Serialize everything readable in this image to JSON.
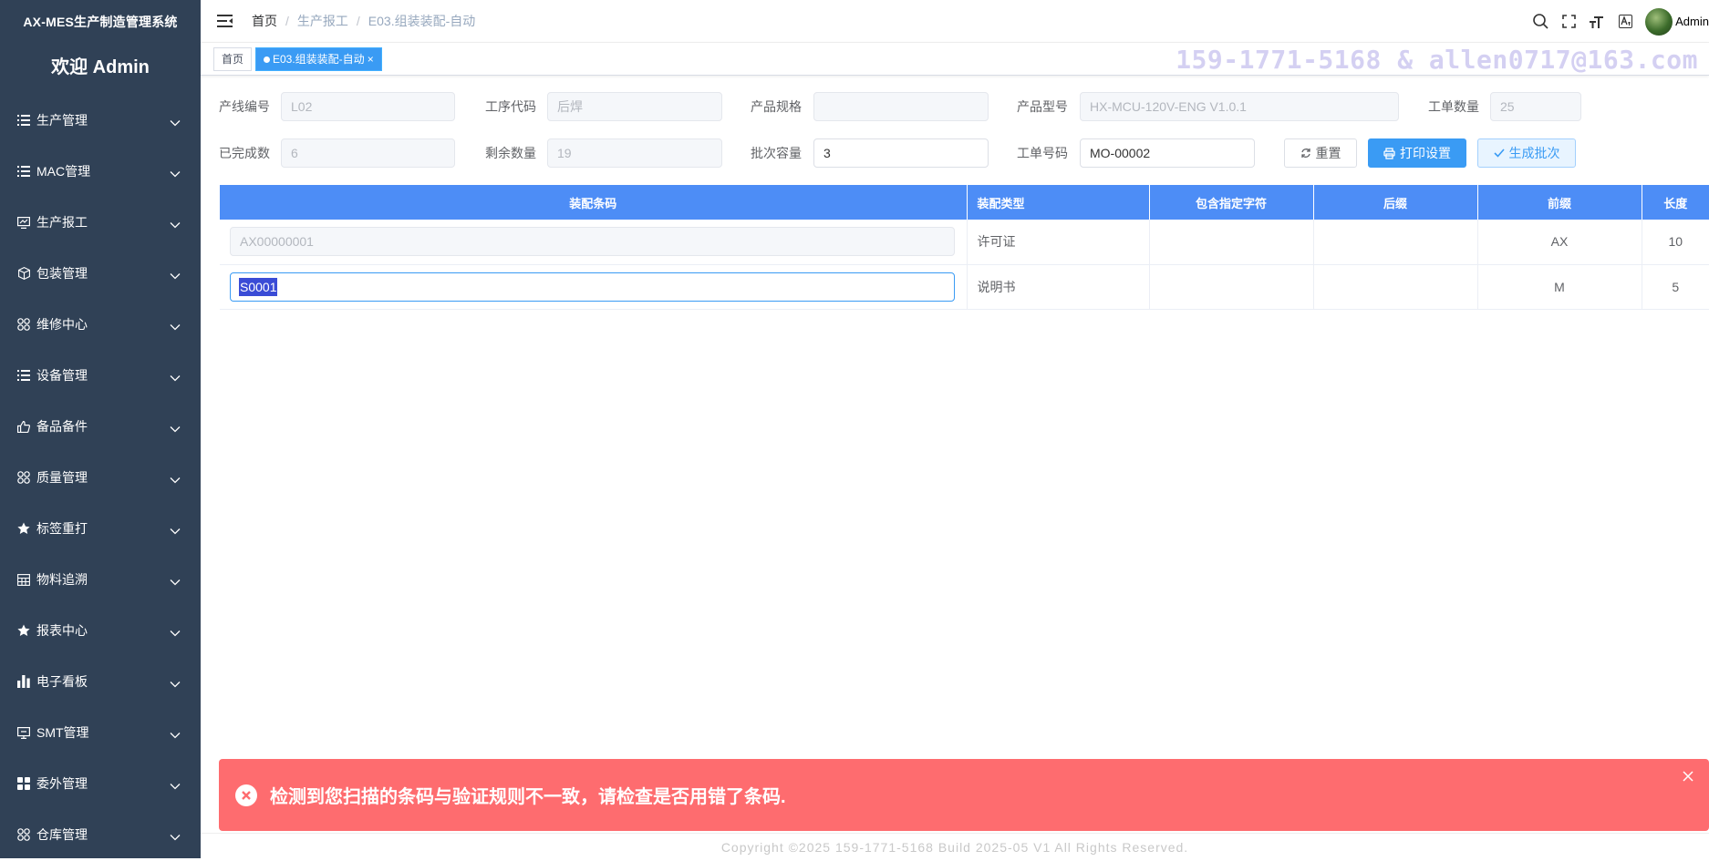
{
  "sidebar": {
    "system_title": "AX-MES生产制造管理系统",
    "welcome": "欢迎 Admin",
    "items": [
      {
        "label": "生产管理",
        "icon": "list-icon"
      },
      {
        "label": "MAC管理",
        "icon": "list-icon"
      },
      {
        "label": "生产报工",
        "icon": "monitor-chart-icon"
      },
      {
        "label": "包装管理",
        "icon": "box-icon"
      },
      {
        "label": "维修中心",
        "icon": "grid-icon"
      },
      {
        "label": "设备管理",
        "icon": "list-icon"
      },
      {
        "label": "备品备件",
        "icon": "thumb-icon"
      },
      {
        "label": "质量管理",
        "icon": "grid-icon"
      },
      {
        "label": "标签重打",
        "icon": "star-icon"
      },
      {
        "label": "物料追溯",
        "icon": "table-icon"
      },
      {
        "label": "报表中心",
        "icon": "star-icon"
      },
      {
        "label": "电子看板",
        "icon": "bar-chart-icon"
      },
      {
        "label": "SMT管理",
        "icon": "monitor-icon"
      },
      {
        "label": "委外管理",
        "icon": "apps-icon"
      },
      {
        "label": "仓库管理",
        "icon": "grid-icon"
      }
    ]
  },
  "navbar": {
    "breadcrumb": [
      "首页",
      "生产报工",
      "E03.组装装配-自动"
    ],
    "user": "Admin"
  },
  "tags": {
    "home": "首页",
    "active": "E03.组装装配-自动",
    "close_glyph": "×"
  },
  "watermark": "159-1771-5168 & allen0717@163.com",
  "form": {
    "line_code": {
      "label": "产线编号",
      "value": "L02"
    },
    "process_code": {
      "label": "工序代码",
      "value": "后焊"
    },
    "product_spec": {
      "label": "产品规格",
      "value": ""
    },
    "product_model": {
      "label": "产品型号",
      "value": "HX-MCU-120V-ENG V1.0.1"
    },
    "order_qty": {
      "label": "工单数量",
      "value": "25"
    },
    "completed": {
      "label": "已完成数",
      "value": "6"
    },
    "remaining": {
      "label": "剩余数量",
      "value": "19"
    },
    "batch_capacity": {
      "label": "批次容量",
      "value": "3"
    },
    "order_no": {
      "label": "工单号码",
      "value": "MO-00002"
    },
    "buttons": {
      "reset": "重置",
      "print": "打印设置",
      "generate": "生成批次"
    }
  },
  "table": {
    "columns": [
      "装配条码",
      "装配类型",
      "包含指定字符",
      "后缀",
      "前缀",
      "长度"
    ],
    "rows": [
      {
        "barcode": "AX00000001",
        "type": "许可证",
        "contains": "",
        "suffix": "",
        "prefix": "AX",
        "length": "10"
      },
      {
        "barcode": "S0001",
        "type": "说明书",
        "contains": "",
        "suffix": "",
        "prefix": "M",
        "length": "5"
      }
    ]
  },
  "alert": {
    "message": "检测到您扫描的条码与验证规则不一致，请检查是否用错了条码.",
    "color": "#fe6c6f"
  },
  "footer": "Copyright ©2025 159-1771-5168 Build 2025-05 V1 All Rights Reserved.",
  "colors": {
    "sidebar_bg": "#304156",
    "primary": "#3a9bf4",
    "table_header": "#4d8df6"
  }
}
